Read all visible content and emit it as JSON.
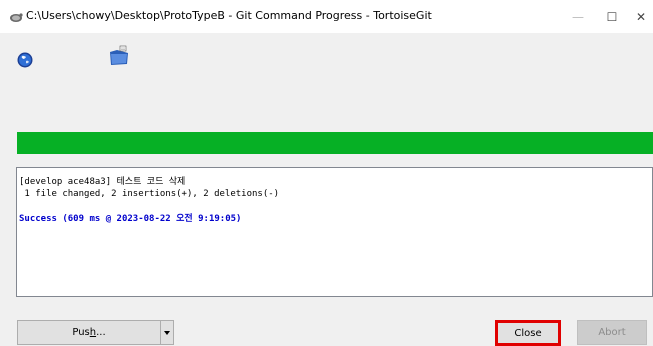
{
  "window": {
    "title": "C:\\Users\\chowy\\Desktop\\ProtoTypeB - Git Command Progress - TortoiseGit",
    "minimize_glyph": "—",
    "maximize_glyph": "☐",
    "close_glyph": "✕"
  },
  "icons": {
    "app": "tortoisegit-icon",
    "status": "globe-icon",
    "repo": "repository-folder-icon"
  },
  "progress": {
    "percent": 100,
    "color": "#06b025"
  },
  "log": {
    "lines": [
      "[develop ace48a3] 테스트 코드 삭제",
      " 1 file changed, 2 insertions(+), 2 deletions(-)"
    ],
    "success": "Success (609 ms @ 2023-08-22 오전 9:19:05)",
    "success_color": "#0000cc"
  },
  "buttons": {
    "push_prefix": "Pus",
    "push_mnemonic": "h",
    "push_suffix": "...",
    "close": "Close",
    "abort": "Abort"
  },
  "colors": {
    "highlight": "#e00000"
  }
}
